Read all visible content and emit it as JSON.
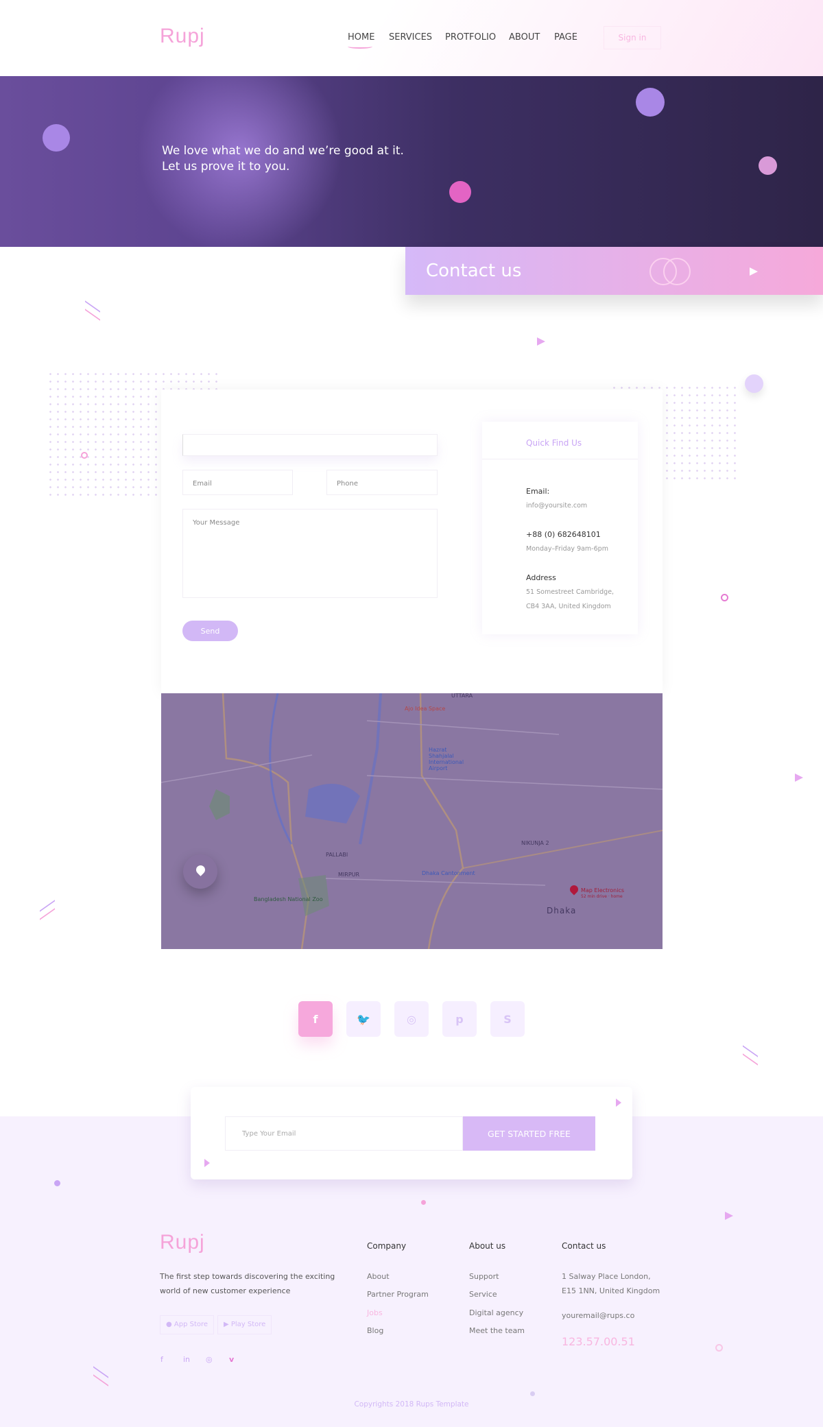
{
  "header": {
    "logo": "Rupj",
    "nav": [
      "HOME",
      "SERVICES",
      "PROTFOLIO",
      "ABOUT",
      "PAGE"
    ],
    "active": "HOME",
    "signin": "Sign in"
  },
  "hero": {
    "line1": "We love what we do and we’re good at it.",
    "line2": "Let us prove it to you."
  },
  "banner": {
    "title": "Contact us"
  },
  "form": {
    "name_value": "",
    "email_placeholder": "Email",
    "phone_placeholder": "Phone",
    "message_placeholder": "Your Message",
    "send": "Send"
  },
  "quickfind": {
    "title": "Quick Find Us",
    "email_label": "Email:",
    "email": "info@yoursite.com",
    "phone": "+88 (0) 682648101",
    "hours": "Monday–Friday 9am-6pm",
    "address_label": "Address",
    "address1": "51 Somestreet Cambridge,",
    "address2": "CB4 3AA, United Kingdom"
  },
  "map": {
    "labels": [
      "UTTARA",
      "Ajo Idea Space",
      "Hazrat Shahjalal International Airport",
      "PALLABI",
      "MIRPUR",
      "Bangladesh National Zoo",
      "Dhaka Cantonment",
      "NIKUNJA 2",
      "Map Electronics",
      "52 min drive · home",
      "Dhaka"
    ]
  },
  "social": [
    {
      "icon": "facebook-icon",
      "glyph": "f",
      "active": true
    },
    {
      "icon": "twitter-icon",
      "glyph": "🐦"
    },
    {
      "icon": "dribbble-icon",
      "glyph": "◎"
    },
    {
      "icon": "pinterest-icon",
      "glyph": "p"
    },
    {
      "icon": "skype-icon",
      "glyph": "S"
    }
  ],
  "newsletter": {
    "placeholder": "Type Your Email",
    "button": "GET STARTED FREE"
  },
  "footer": {
    "logo": "Rupj",
    "tagline1": "The first step towards discovering the exciting",
    "tagline2": "world of new customer experience",
    "app_store": "App Store",
    "play_store": "Play Store",
    "company": {
      "title": "Company",
      "links": [
        "About",
        "Partner Program",
        "Jobs",
        "Blog"
      ]
    },
    "about": {
      "title": "About us",
      "links": [
        "Support",
        "Service",
        "Digital agency",
        "Meet the team"
      ]
    },
    "contact": {
      "title": "Contact us",
      "address1": "1 Salway Place London,",
      "address2": "E15 1NN, United Kingdom",
      "email": "youremail@rups.co",
      "phone": "123.57.00.51"
    },
    "social": [
      "f",
      "in",
      "◎",
      "v"
    ],
    "copyright": "Copyrights 2018 Rups Template"
  },
  "colors": {
    "pink": "#f5a3d9",
    "lavender": "#d2b8f6",
    "footer_bg": "#f7f1fe"
  }
}
